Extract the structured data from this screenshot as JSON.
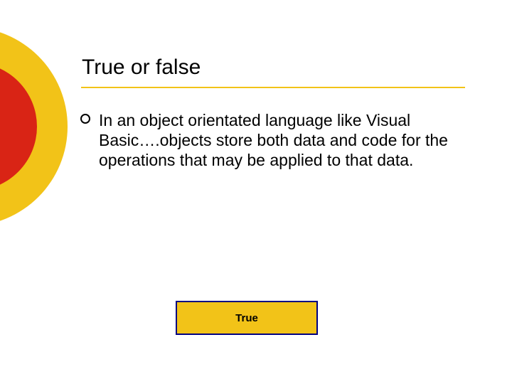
{
  "colors": {
    "accent_yellow": "#f2c318",
    "accent_red": "#d92415",
    "box_border": "#000080"
  },
  "slide": {
    "title": "True or false",
    "bullet": "In an object orientated language like Visual Basic….objects store both data and code for the operations that may be applied to that data.",
    "answer": "True"
  }
}
